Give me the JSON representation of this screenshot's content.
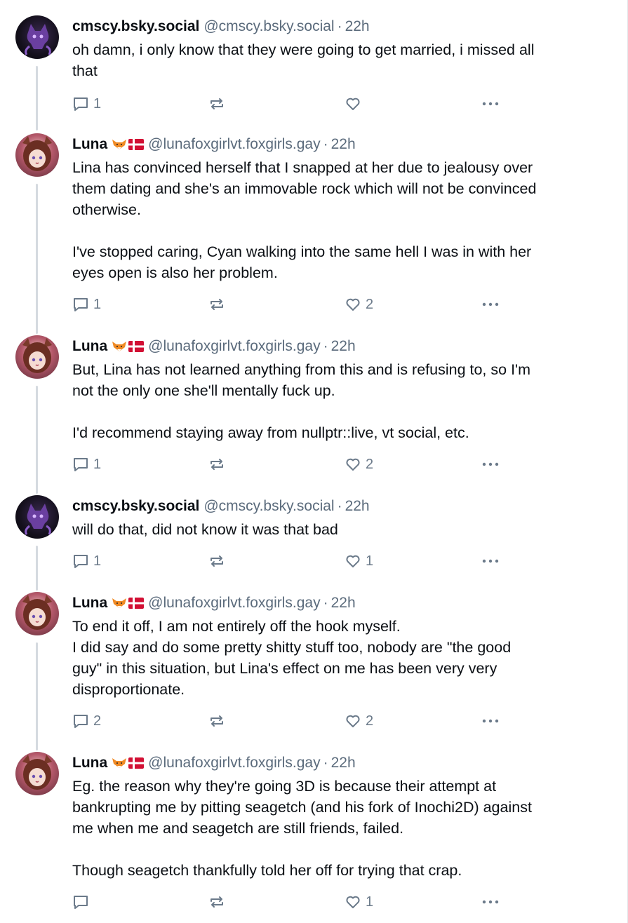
{
  "posts": [
    {
      "author": "cmscy.bsky.social",
      "emoji": "",
      "handle": "@cmscy.bsky.social",
      "separator": "·",
      "time": "22h",
      "text": "oh damn, i only know that they were going to get married, i missed all\nthat",
      "replies": "1",
      "reposts": "",
      "likes": "",
      "avatar": "purple-cat-avatar"
    },
    {
      "author": "Luna",
      "emoji": "🦊🇩🇰",
      "handle": "@lunafoxgirlvt.foxgirls.gay",
      "separator": "·",
      "time": "22h",
      "text": "Lina has convinced herself that I snapped at her due to jealousy over\nthem dating and she's an immovable rock which will not be convinced\notherwise.\n\nI've stopped caring, Cyan walking into the same hell I was in with her\neyes open is also her problem.",
      "replies": "1",
      "reposts": "",
      "likes": "2",
      "avatar": "foxgirl-avatar"
    },
    {
      "author": "Luna",
      "emoji": "🦊🇩🇰",
      "handle": "@lunafoxgirlvt.foxgirls.gay",
      "separator": "·",
      "time": "22h",
      "text": "But, Lina has not learned anything from this and is refusing to, so I'm\nnot the only one she'll mentally fuck up.\n\nI'd recommend staying away from nullptr::live, vt social, etc.",
      "replies": "1",
      "reposts": "",
      "likes": "2",
      "avatar": "foxgirl-avatar"
    },
    {
      "author": "cmscy.bsky.social",
      "emoji": "",
      "handle": "@cmscy.bsky.social",
      "separator": "·",
      "time": "22h",
      "text": "will do that, did not know it was that bad",
      "replies": "1",
      "reposts": "",
      "likes": "1",
      "avatar": "purple-cat-avatar"
    },
    {
      "author": "Luna",
      "emoji": "🦊🇩🇰",
      "handle": "@lunafoxgirlvt.foxgirls.gay",
      "separator": "·",
      "time": "22h",
      "text": "To end it off, I am not entirely off the hook myself.\nI did say and do some pretty shitty stuff too, nobody are \"the good\nguy\" in this situation, but Lina's effect on me has been very very\ndisproportionate.",
      "replies": "2",
      "reposts": "",
      "likes": "2",
      "avatar": "foxgirl-avatar"
    },
    {
      "author": "Luna",
      "emoji": "🦊🇩🇰",
      "handle": "@lunafoxgirlvt.foxgirls.gay",
      "separator": "·",
      "time": "22h",
      "text": "Eg. the reason why they're going 3D is because their attempt at\nbankrupting me by pitting seagetch (and his fork of Inochi2D) against\nme when me and seagetch are still friends, failed.\n\nThough seagetch thankfully told her off for trying that crap.",
      "replies": "",
      "reposts": "",
      "likes": "1",
      "avatar": "foxgirl-avatar"
    }
  ],
  "icons": {
    "reply": "reply-icon",
    "repost": "repost-icon",
    "like": "heart-icon",
    "more": "more-options-icon"
  },
  "colors": {
    "text": "#0b0f14",
    "muted": "#5b6b7c",
    "icon": "#6b7a8a",
    "thread_line": "#d5dae0"
  }
}
